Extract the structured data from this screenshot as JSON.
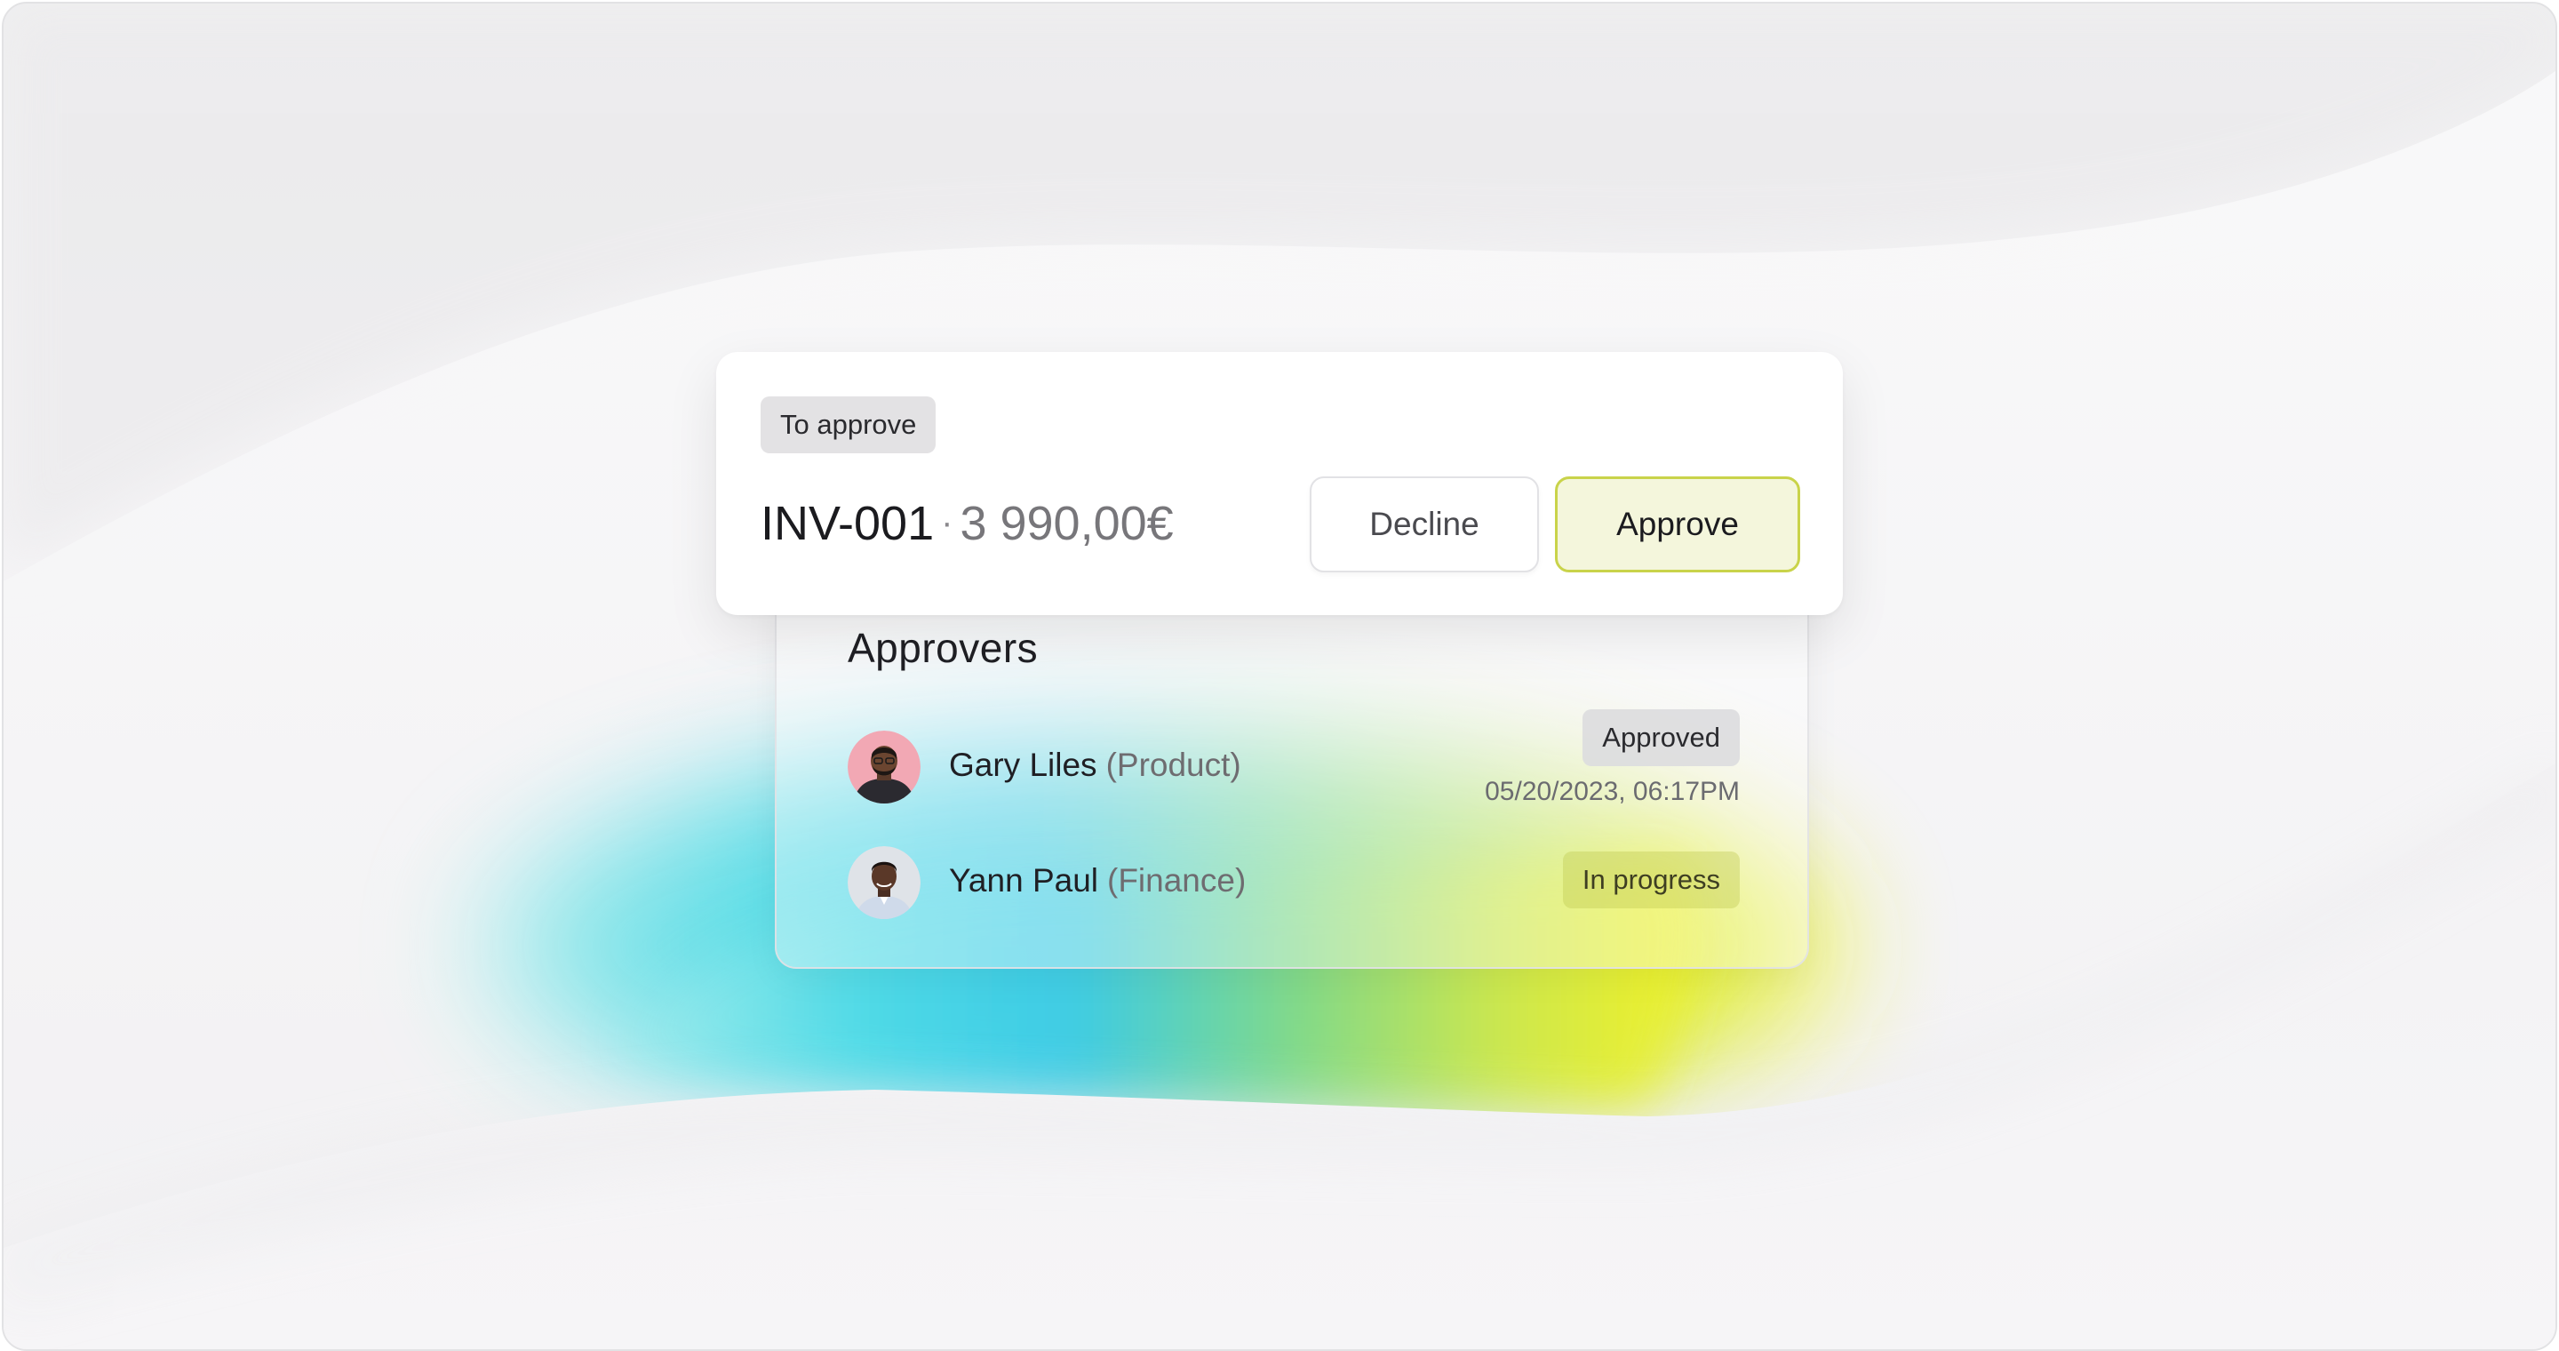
{
  "invoice": {
    "status_badge": "To approve",
    "id": "INV-001",
    "separator": "·",
    "amount": "3 990,00€",
    "decline_label": "Decline",
    "approve_label": "Approve"
  },
  "approvers": {
    "title": "Approvers",
    "items": [
      {
        "name": "Gary Liles",
        "department": "(Product)",
        "status": "Approved",
        "timestamp": "05/20/2023, 06:17PM",
        "avatar_color": "#f2a8b4"
      },
      {
        "name": "Yann Paul",
        "department": "(Finance)",
        "status": "In progress",
        "timestamp": "",
        "avatar_color": "#dfe3e8"
      }
    ]
  },
  "colors": {
    "approve_accent": "#c9d34a",
    "approve_fill": "#f4f6dc",
    "gradient_cyan": "#3dc8e6",
    "gradient_yellow": "#eef025"
  }
}
